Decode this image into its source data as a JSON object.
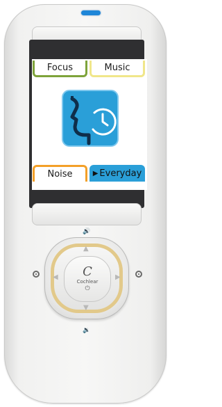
{
  "device": {
    "modes": {
      "focus": "Focus",
      "music": "Music",
      "noise": "Noise",
      "everyday": "Everyday",
      "selected_marker": "▶"
    },
    "program_icon": "face-clock-icon",
    "center_button": {
      "logo": "C",
      "brand": "Cochlear",
      "power_symbol": "⏻"
    },
    "volume_up_icon": "🔊",
    "volume_down_icon": "🔉"
  }
}
